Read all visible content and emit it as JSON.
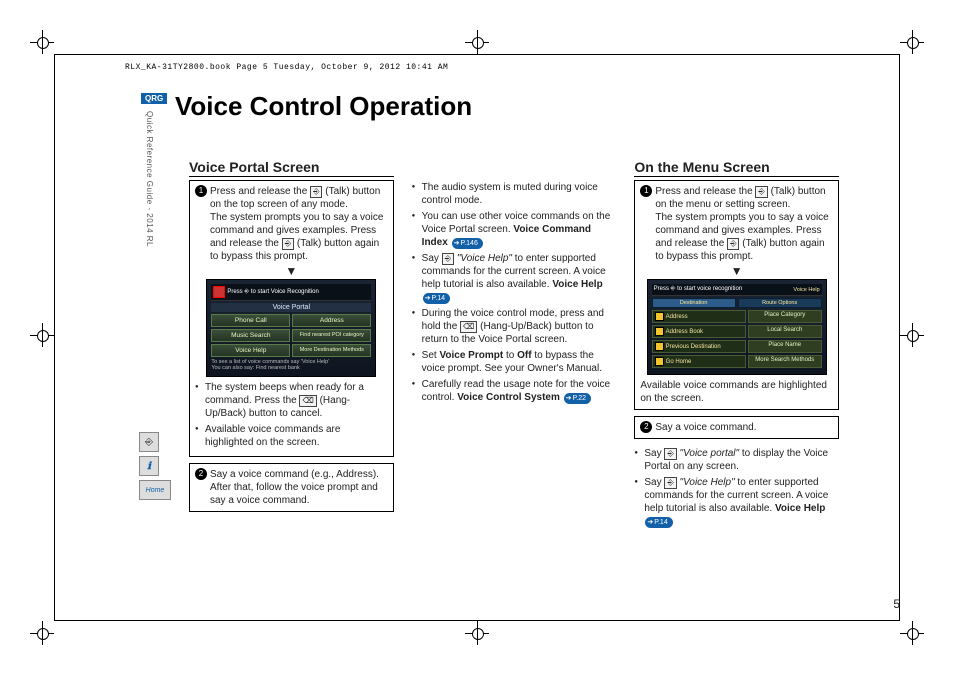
{
  "header_line": "RLX_KA-31TY2800.book  Page 5  Tuesday, October 9, 2012  10:41 AM",
  "qrg": "QRG",
  "side_label": "Quick Reference Guide - 2014 RL",
  "title": "Voice Control Operation",
  "page_number": "5",
  "side_icons": {
    "talk": "⎆",
    "info": "ℹ",
    "home": "Home"
  },
  "col1": {
    "heading": "Voice Portal Screen",
    "step1_a": "Press and release the ",
    "talk_icon_label": "⎆",
    "step1_b": " (Talk) button on the top screen of any mode.",
    "step1_c": "The system prompts you to say a voice command and gives examples. Press and release the ",
    "step1_d": " (Talk) button again to bypass this prompt.",
    "shot_bar": "Press ⎆ to start Voice Recognition",
    "shot_title": "Voice Portal",
    "shot_cells": [
      "Phone Call",
      "Address",
      "Music Search",
      "Find nearest POI category",
      "Voice Help",
      "More Destination Methods"
    ],
    "shot_foot1": "To see a list of voice commands say 'Voice Help'",
    "shot_foot2": "You can also say: Find nearest bank",
    "b1": "The system beeps when ready for a command. Press the ",
    "b1_icon": "⌫",
    "b1_end": " (Hang-Up/Back) button to cancel.",
    "b2": "Available voice commands are highlighted on the screen.",
    "step2": "Say a voice command (e.g., Address). After that, follow the voice prompt and say a voice command."
  },
  "col2": {
    "b1": "The audio system is muted during voice control mode.",
    "b2a": "You can use other voice commands on the Voice Portal screen. ",
    "b2b": "Voice Command Index",
    "ref1": "P.146",
    "b3a": "Say ",
    "b3b": "\"Voice Help\"",
    "b3c": " to enter supported commands for the current screen. A voice help tutorial is also available. ",
    "b3d": "Voice Help",
    "ref2": "P.14",
    "b4a": "During the voice control mode, press and hold the ",
    "b4_icon": "⌫",
    "b4b": " (Hang-Up/Back) button to return to the Voice Portal screen.",
    "b5a": "Set ",
    "b5b": "Voice Prompt",
    "b5c": " to ",
    "b5d": "Off",
    "b5e": " to bypass the voice prompt. See your Owner's Manual.",
    "b6a": "Carefully read the usage note for the voice control. ",
    "b6b": "Voice Control System",
    "ref3": "P.22"
  },
  "col3": {
    "heading": "On the Menu Screen",
    "step1_a": "Press and release the ",
    "step1_b": " (Talk) button on the menu or setting screen.",
    "step1_c": "The system prompts you to say a voice command and gives examples. Press and release the ",
    "step1_d": " (Talk) button again to bypass this prompt.",
    "shot_bar": "Press ⎆ to start voice recognition",
    "shot_tabs": [
      "Destination",
      "Route Options"
    ],
    "shot_helper": "Voice Help",
    "shot_rows_left": [
      "Address",
      "Address Book",
      "Previous Destination",
      "Go Home"
    ],
    "shot_rows_right": [
      "Place Category",
      "Local Search",
      "Place Name",
      "More Search Methods"
    ],
    "caption": "Available voice commands are highlighted on the screen.",
    "step2": "Say a voice command.",
    "b1a": "Say ",
    "b1b": "\"Voice portal\"",
    "b1c": " to display the Voice Portal on any screen.",
    "b2a": "Say ",
    "b2b": "\"Voice Help\"",
    "b2c": " to enter supported commands for the current screen. A voice help tutorial is also available. ",
    "b2d": "Voice Help",
    "ref1": "P.14"
  }
}
